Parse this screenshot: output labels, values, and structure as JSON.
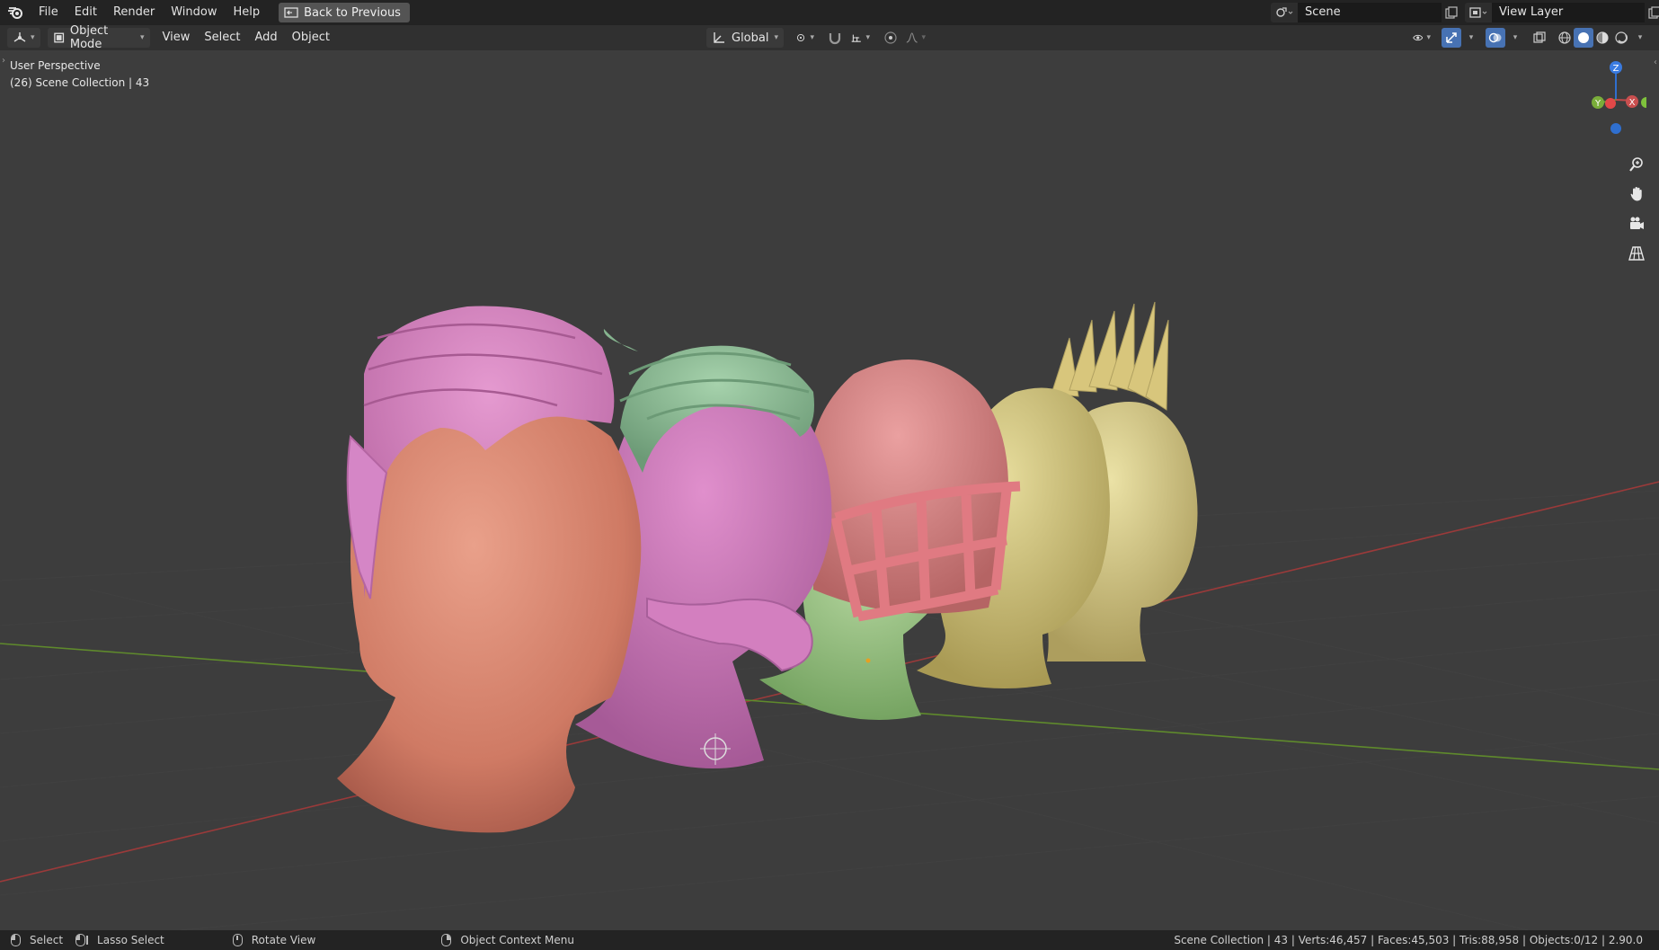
{
  "topbar": {
    "menu": [
      "File",
      "Edit",
      "Render",
      "Window",
      "Help"
    ],
    "back_button": "Back to Previous",
    "scene": "Scene",
    "view_layer": "View Layer"
  },
  "viewport_header": {
    "mode": "Object Mode",
    "menus": [
      "View",
      "Select",
      "Add",
      "Object"
    ],
    "transform_orientation": "Global"
  },
  "viewport": {
    "perspective": "User Perspective",
    "collection": "(26) Scene Collection | 43",
    "gizmo_axes": {
      "z": "Z",
      "y": "Y",
      "x": "X"
    },
    "colors": {
      "background": "#3d3d3d",
      "grid_x_axis": "#9a3a3a",
      "grid_y_axis": "#5f8a2c",
      "head1_skin": "#d9826a",
      "head1_hair": "#cf78b8",
      "head2_skin": "#c873b6",
      "head2_hair": "#86b58f",
      "head3_skin": "#8fba7a",
      "head3_helmet": "#d98585",
      "head4_skin": "#d2c67a",
      "head5_skin": "#d6cd86",
      "head5_hair": "#d8c67c"
    }
  },
  "statusbar": {
    "select": "Select",
    "lasso": "Lasso Select",
    "rotate": "Rotate View",
    "context": "Object Context Menu",
    "stats": "Scene Collection | 43 | Verts:46,457 | Faces:45,503 | Tris:88,958 | Objects:0/12 | 2.90.0"
  }
}
